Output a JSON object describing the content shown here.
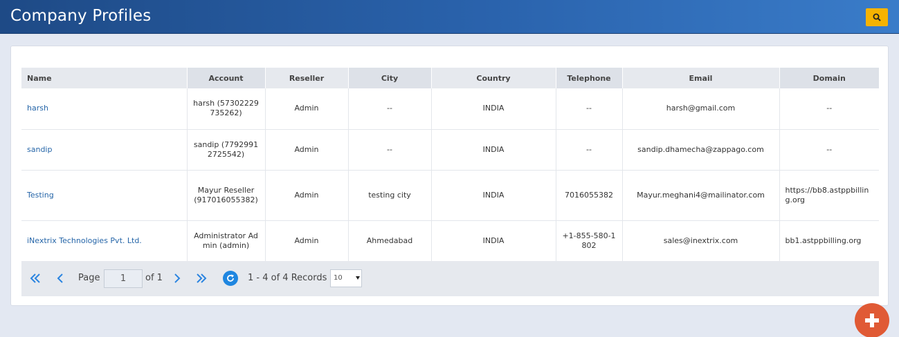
{
  "header": {
    "title": "Company Profiles"
  },
  "table": {
    "columns": [
      "Name",
      "Account",
      "Reseller",
      "City",
      "Country",
      "Telephone",
      "Email",
      "Domain"
    ],
    "rows": [
      {
        "name": "harsh",
        "account": "harsh (57302229735262)",
        "reseller": "Admin",
        "city": "--",
        "country": "INDIA",
        "telephone": "--",
        "email": "harsh@gmail.com",
        "domain": "--"
      },
      {
        "name": "sandip",
        "account": "sandip (77929912725542)",
        "reseller": "Admin",
        "city": "--",
        "country": "INDIA",
        "telephone": "--",
        "email": "sandip.dhamecha@zappago.com",
        "domain": "--"
      },
      {
        "name": "Testing",
        "account": "Mayur Reseller (917016055382)",
        "reseller": "Admin",
        "city": "testing city",
        "country": "INDIA",
        "telephone": "7016055382",
        "email": "Mayur.meghani4@mailinator.com",
        "domain": "https://bb8.astppbilling.org"
      },
      {
        "name": "iNextrix Technologies Pvt. Ltd.",
        "account": "Administrator Admin (admin)",
        "reseller": "Admin",
        "city": "Ahmedabad",
        "country": "INDIA",
        "telephone": "+1-855-580-1802",
        "email": "sales@inextrix.com",
        "domain": "bb1.astppbilling.org"
      }
    ]
  },
  "pager": {
    "page_label": "Page",
    "page_value": "1",
    "of_label": "of 1",
    "records_label": "1 - 4 of 4 Records",
    "page_size": "10"
  },
  "colors": {
    "header_bg": "#2a63ad",
    "accent": "#f6b300",
    "link": "#2565a8",
    "fab": "#e05a35",
    "pager_icon": "#2a84e0"
  },
  "icons": {
    "search": "search-icon",
    "first": "double-chevron-left-icon",
    "prev": "chevron-left-icon",
    "next": "chevron-right-icon",
    "last": "double-chevron-right-icon",
    "refresh": "refresh-icon",
    "add": "plus-icon"
  }
}
